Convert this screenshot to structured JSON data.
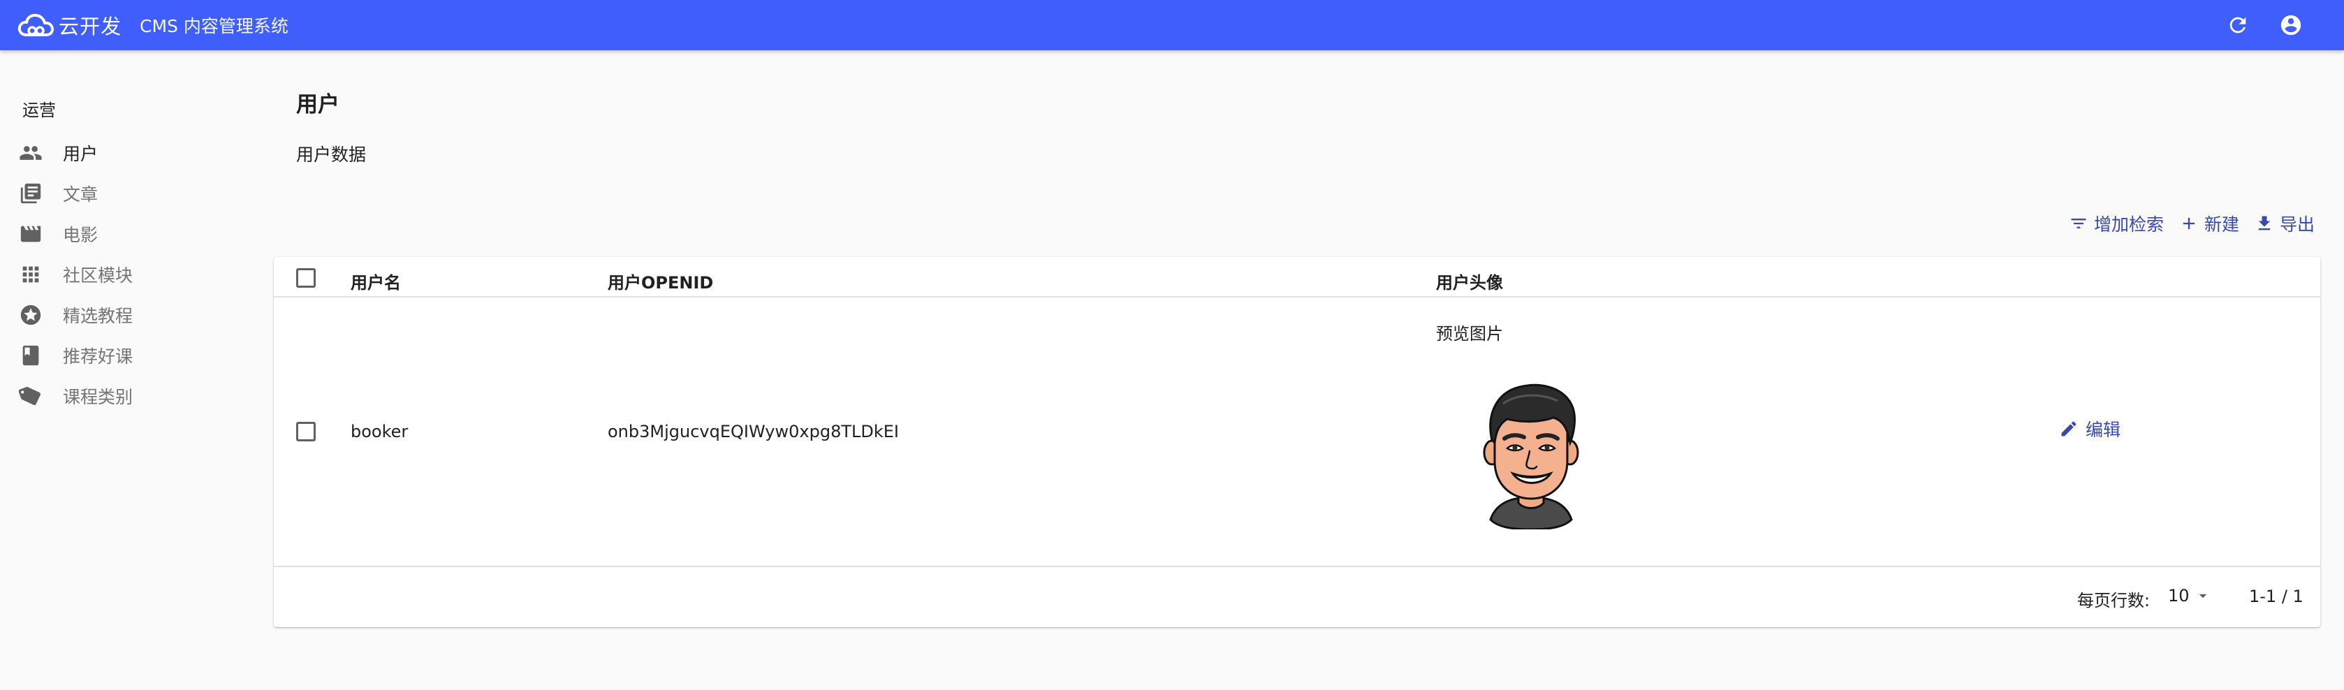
{
  "header": {
    "brand": "云开发",
    "title": "CMS 内容管理系统",
    "actions": [
      {
        "name": "refresh",
        "icon": "refresh-icon"
      },
      {
        "name": "account",
        "icon": "account-circle-icon"
      }
    ]
  },
  "sidebar": {
    "section_title": "运营",
    "items": [
      {
        "label": "用户",
        "icon": "people-icon",
        "active": true
      },
      {
        "label": "文章",
        "icon": "library-books-icon"
      },
      {
        "label": "电影",
        "icon": "movie-icon"
      },
      {
        "label": "社区模块",
        "icon": "apps-grid-icon"
      },
      {
        "label": "精选教程",
        "icon": "star-circle-icon"
      },
      {
        "label": "推荐好课",
        "icon": "book-icon"
      },
      {
        "label": "课程类别",
        "icon": "tags-icon"
      }
    ]
  },
  "main": {
    "title": "用户",
    "subtitle": "用户数据",
    "toolbar": {
      "filter_label": "增加检索",
      "create_label": "新建",
      "export_label": "导出"
    },
    "table": {
      "columns": [
        "用户名",
        "用户OPENID",
        "用户头像"
      ],
      "rows": [
        {
          "username": "booker",
          "openid": "onb3MjgucvqEQIWyw0xpg8TLDkEI",
          "avatar_label": "预览图片",
          "edit_label": "编辑"
        }
      ],
      "footer": {
        "rows_per_page_label": "每页行数:",
        "rows_per_page_value": "10",
        "page_range": "1-1 / 1"
      }
    }
  },
  "colors": {
    "primary": "#3f5efb",
    "accent_text": "#3949ab",
    "background": "#fafafa"
  }
}
